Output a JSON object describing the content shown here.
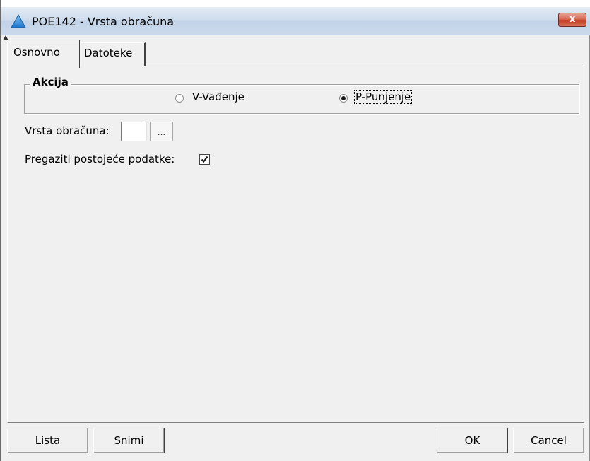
{
  "window": {
    "title": "POE142 - Vrsta obračuna",
    "close_label": "x"
  },
  "tabs": [
    {
      "label": "Osnovno",
      "active": true
    },
    {
      "label": "Datoteke",
      "active": false
    }
  ],
  "akcija": {
    "legend": "Akcija",
    "options": [
      {
        "label": "V-Vađenje",
        "selected": false
      },
      {
        "label": "P-Punjenje",
        "selected": true
      }
    ]
  },
  "vrsta_obracuna": {
    "label": "Vrsta obračuna:",
    "value": "",
    "browse_label": "..."
  },
  "pregaziti": {
    "label": "Pregaziti postojeće podatke:",
    "checked": true
  },
  "buttons": {
    "lista": {
      "underline": "L",
      "rest": "ista"
    },
    "snimi": {
      "underline": "S",
      "rest": "nimi"
    },
    "ok": {
      "underline": "O",
      "rest": "K"
    },
    "cancel": {
      "underline": "C",
      "rest": "ancel"
    }
  },
  "icons": {
    "app": "app-triangle-icon",
    "close": "close-icon",
    "check": "check-icon"
  }
}
